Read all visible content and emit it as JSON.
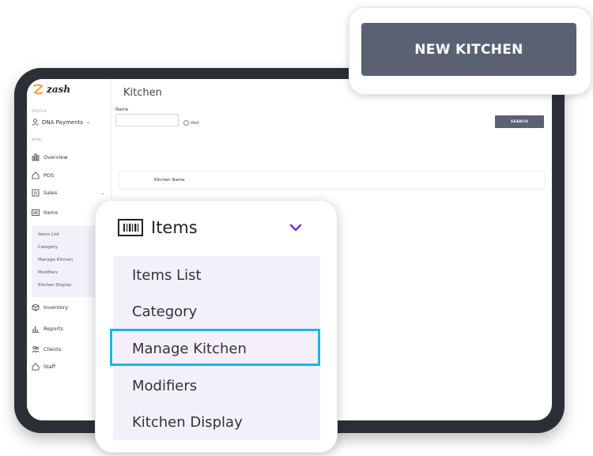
{
  "brand": {
    "name": "zash"
  },
  "sidebar": {
    "profile_label": "PROFILE",
    "account": "DNA Payments",
    "menu_label": "MENU",
    "items": [
      {
        "label": "Overview",
        "icon": "overview-icon"
      },
      {
        "label": "POS",
        "icon": "home-icon"
      },
      {
        "label": "Sales",
        "icon": "sales-icon"
      },
      {
        "label": "Items",
        "icon": "barcode-icon"
      },
      {
        "label": "Inventory",
        "icon": "box-icon"
      },
      {
        "label": "Reports",
        "icon": "chart-icon"
      },
      {
        "label": "Clients",
        "icon": "clients-icon"
      },
      {
        "label": "Staff",
        "icon": "home-icon"
      }
    ],
    "submenu": [
      "Items List",
      "Category",
      "Manage Kitchen",
      "Modifiers",
      "Kitchen Display"
    ]
  },
  "main": {
    "title": "Kitchen",
    "filter": {
      "name_label": "Name",
      "radio_label": "Wait"
    },
    "search_button": "SEARCH",
    "table": {
      "columns": [
        "Kitchen Name"
      ]
    }
  },
  "callout_new_kitchen": {
    "label": "NEW KITCHEN"
  },
  "callout_items": {
    "title": "Items",
    "options": [
      "Items List",
      "Category",
      "Manage Kitchen",
      "Modifiers",
      "Kitchen Display"
    ],
    "highlighted": "Manage Kitchen"
  },
  "colors": {
    "accent": "#7b2fbe",
    "highlight": "#18b7e8",
    "button": "#5a6173",
    "submenu_bg": "#f3f0fa"
  }
}
